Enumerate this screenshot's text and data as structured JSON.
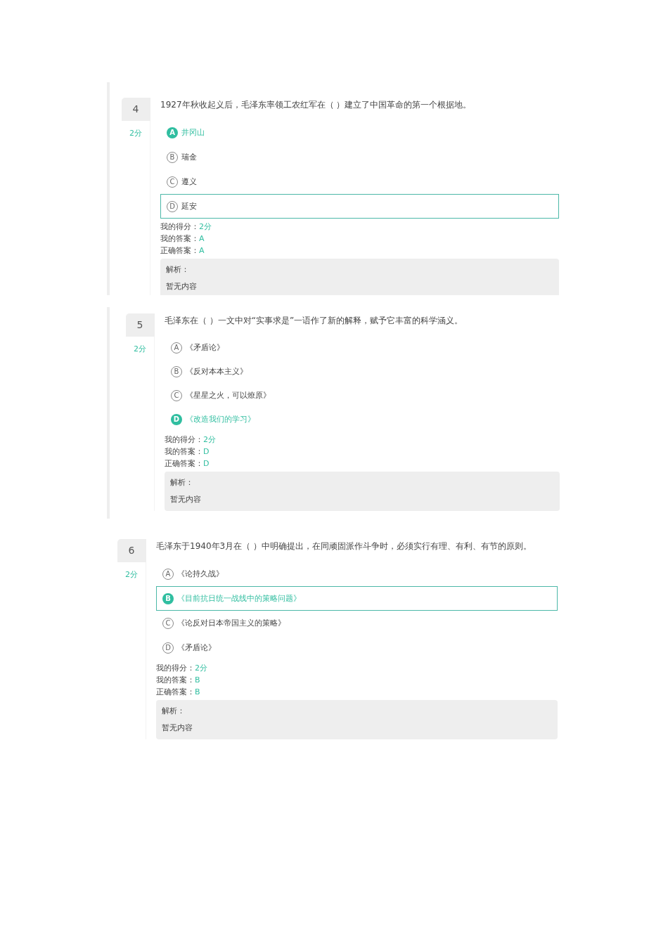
{
  "questions": [
    {
      "number": "4",
      "points": "2分",
      "left_border": true,
      "text": "1927年秋收起义后，毛泽东率领工农红军在（ ）建立了中国革命的第一个根据地。",
      "options": [
        {
          "letter": "A",
          "text": "井冈山",
          "selected": true,
          "hovered": false
        },
        {
          "letter": "B",
          "text": "瑞金",
          "selected": false,
          "hovered": false
        },
        {
          "letter": "C",
          "text": "遵义",
          "selected": false,
          "hovered": false
        },
        {
          "letter": "D",
          "text": "延安",
          "selected": false,
          "hovered": true
        }
      ],
      "results": [
        {
          "label": "我的得分：",
          "value": "2分"
        },
        {
          "label": "我的答案：",
          "value": "A"
        },
        {
          "label": "正确答案：",
          "value": "A"
        }
      ],
      "analysis": {
        "heading": "解析：",
        "text": "暂无内容"
      }
    },
    {
      "number": "5",
      "points": "2分",
      "left_border": true,
      "text": "毛泽东在（ ）一文中对“实事求是”一语作了新的解释，赋予它丰富的科学涵义。",
      "options": [
        {
          "letter": "A",
          "text": "《矛盾论》",
          "selected": false,
          "hovered": false
        },
        {
          "letter": "B",
          "text": "《反对本本主义》",
          "selected": false,
          "hovered": false
        },
        {
          "letter": "C",
          "text": "《星星之火，可以燎原》",
          "selected": false,
          "hovered": false
        },
        {
          "letter": "D",
          "text": "《改造我们的学习》",
          "selected": true,
          "hovered": false
        }
      ],
      "results": [
        {
          "label": "我的得分：",
          "value": "2分"
        },
        {
          "label": "我的答案：",
          "value": "D"
        },
        {
          "label": "正确答案：",
          "value": "D"
        }
      ],
      "analysis": {
        "heading": "解析：",
        "text": "暂无内容"
      }
    },
    {
      "number": "6",
      "points": "2分",
      "left_border": false,
      "text": "毛泽东于1940年3月在（ ）中明确提出，在同顽固派作斗争时，必须实行有理、有利、有节的原则。",
      "options": [
        {
          "letter": "A",
          "text": "《论持久战》",
          "selected": false,
          "hovered": false
        },
        {
          "letter": "B",
          "text": "《目前抗日统一战线中的策略问题》",
          "selected": true,
          "hovered": true
        },
        {
          "letter": "C",
          "text": "《论反对日本帝国主义的策略》",
          "selected": false,
          "hovered": false
        },
        {
          "letter": "D",
          "text": "《矛盾论》",
          "selected": false,
          "hovered": false
        }
      ],
      "results": [
        {
          "label": "我的得分：",
          "value": "2分"
        },
        {
          "label": "我的答案：",
          "value": "B"
        },
        {
          "label": "正确答案：",
          "value": "B"
        }
      ],
      "analysis": {
        "heading": "解析：",
        "text": "暂无内容"
      }
    }
  ]
}
